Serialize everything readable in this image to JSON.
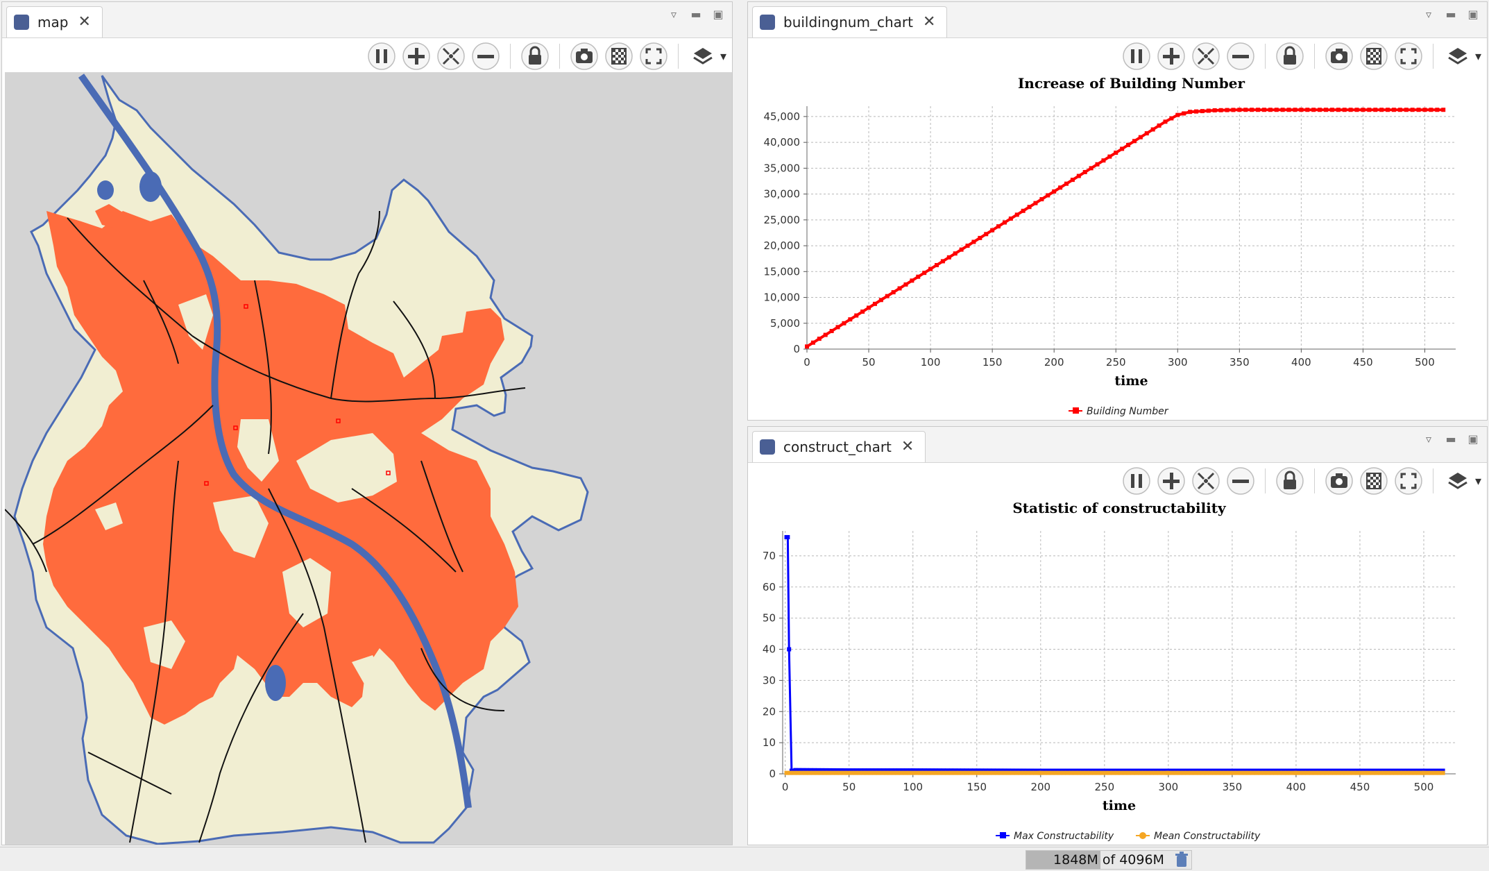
{
  "map_view": {
    "tab_label": "map",
    "colors": {
      "background": "#d4d4d4",
      "land": "#f1eed2",
      "built": "#ff6b3d",
      "water": "#4a6bb5",
      "road": "#111111"
    }
  },
  "toolbar_icons": [
    "pause-icon",
    "zoom-in-icon",
    "zoom-fit-icon",
    "zoom-out-icon",
    "lock-icon",
    "snapshot-icon",
    "overlay-icon",
    "fullscreen-icon",
    "layers-icon"
  ],
  "charts": {
    "building": {
      "tab_label": "buildingnum_chart",
      "title": "Increase of Building Number",
      "xlabel": "time",
      "legend": [
        "Building Number"
      ]
    },
    "construct": {
      "tab_label": "construct_chart",
      "title": "Statistic of constructability",
      "xlabel": "time",
      "legend": [
        "Max Constructability",
        "Mean Constructability"
      ]
    }
  },
  "chart_data": [
    {
      "type": "line",
      "title": "Increase of Building Number",
      "xlabel": "time",
      "ylabel": "",
      "xlim": [
        0,
        525
      ],
      "ylim": [
        0,
        47000
      ],
      "x_ticks": [
        "0",
        "50",
        "100",
        "150",
        "200",
        "250",
        "300",
        "350",
        "400",
        "450",
        "500"
      ],
      "y_ticks": [
        "0",
        "5,000",
        "10,000",
        "15,000",
        "20,000",
        "25,000",
        "30,000",
        "35,000",
        "40,000",
        "45,000"
      ],
      "grid": true,
      "legend_position": "bottom",
      "series": [
        {
          "name": "Building Number",
          "color": "#ff0000",
          "x": [
            0,
            50,
            100,
            150,
            200,
            250,
            290,
            300,
            310,
            330,
            350,
            400,
            450,
            500,
            515
          ],
          "values": [
            500,
            8000,
            15500,
            23000,
            30500,
            38000,
            44000,
            45300,
            45900,
            46200,
            46300,
            46300,
            46300,
            46300,
            46300
          ]
        }
      ]
    },
    {
      "type": "line",
      "title": "Statistic of constructability",
      "xlabel": "time",
      "ylabel": "",
      "xlim": [
        -2,
        525
      ],
      "ylim": [
        0,
        78
      ],
      "x_ticks": [
        "0",
        "50",
        "100",
        "150",
        "200",
        "250",
        "300",
        "350",
        "400",
        "450",
        "500"
      ],
      "y_ticks": [
        "0",
        "10",
        "20",
        "30",
        "40",
        "50",
        "60",
        "70"
      ],
      "grid": true,
      "legend_position": "bottom",
      "series": [
        {
          "name": "Max Constructability",
          "color": "#0000ff",
          "x": [
            1,
            2,
            3,
            5,
            8,
            50,
            100,
            200,
            300,
            400,
            500,
            515
          ],
          "values": [
            76,
            76,
            40,
            1,
            1.2,
            1.1,
            1.1,
            1.0,
            1.0,
            1.0,
            1.0,
            1.0
          ]
        },
        {
          "name": "Mean Constructability",
          "color": "#f5a623",
          "x": [
            1,
            100,
            200,
            300,
            400,
            500,
            515
          ],
          "values": [
            0.3,
            0.3,
            0.3,
            0.3,
            0.3,
            0.3,
            0.3
          ]
        }
      ]
    }
  ],
  "status": {
    "memory_used": "1848M",
    "memory_of": "of",
    "memory_total": "4096M",
    "memory_fraction": 0.45
  }
}
